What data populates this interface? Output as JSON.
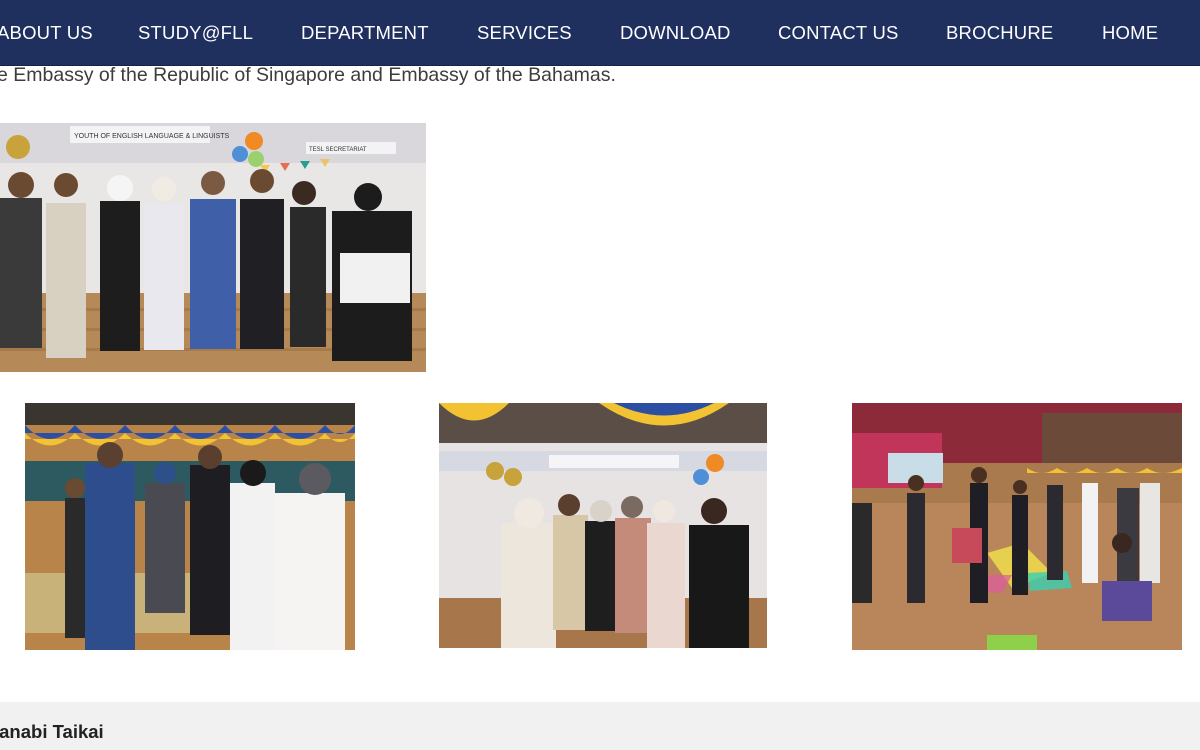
{
  "nav": {
    "items": [
      "ABOUT US",
      "STUDY@FLL",
      "DEPARTMENT",
      "SERVICES",
      "DOWNLOAD",
      "CONTACT US",
      "BROCHURE",
      "HOME"
    ]
  },
  "article": {
    "intro_text": "e Embassy of the Republic of Singapore and Embassy of the Bahamas."
  },
  "gallery": {
    "banner_text": "YOUTH OF ENGLISH LANGUAGE & LINGUISTS",
    "sign_text": "TESL SECRETARIAT"
  },
  "next_section": {
    "heading": "lanabi Taikai"
  },
  "colors": {
    "nav_bg": "#1f2f5e",
    "nav_text": "#ffffff",
    "strip_bg": "#f1f1f1"
  }
}
